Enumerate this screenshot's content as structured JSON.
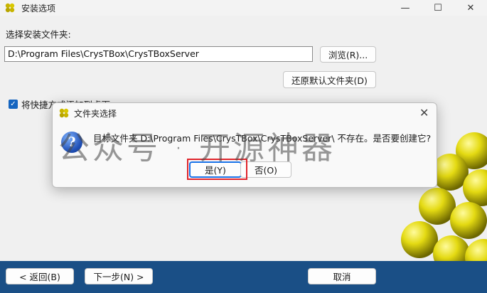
{
  "window": {
    "title": "安装选项",
    "minimize_glyph": "—",
    "maximize_glyph": "☐",
    "close_glyph": "✕"
  },
  "main": {
    "folder_label": "选择安装文件夹:",
    "install_path": "D:\\Program Files\\CrysTBox\\CrysTBoxServer",
    "browse_label": "浏览(R)...",
    "restore_label": "还原默认文件夹(D)",
    "shortcut_checkbox_label": "将快捷方式添加到桌面",
    "shortcut_checked": true
  },
  "bottom_bar": {
    "back_label": "< 返回(B)",
    "next_label": "下一步(N) >",
    "cancel_label": "取消"
  },
  "dialog": {
    "title": "文件夹选择",
    "message": "目标文件夹 D:\\Program Files\\CrysTBox\\CrysTBoxServer\\ 不存在。是否要创建它?",
    "yes_label": "是(Y)",
    "no_label": "否(O)",
    "close_glyph": "✕",
    "question_glyph": "?"
  },
  "watermark": "公众号 · 开源神器",
  "colors": {
    "accent": "#1565c0",
    "bottom_bar": "#1a4f86",
    "highlight": "#e0242b",
    "spheres": "#c9c200"
  }
}
